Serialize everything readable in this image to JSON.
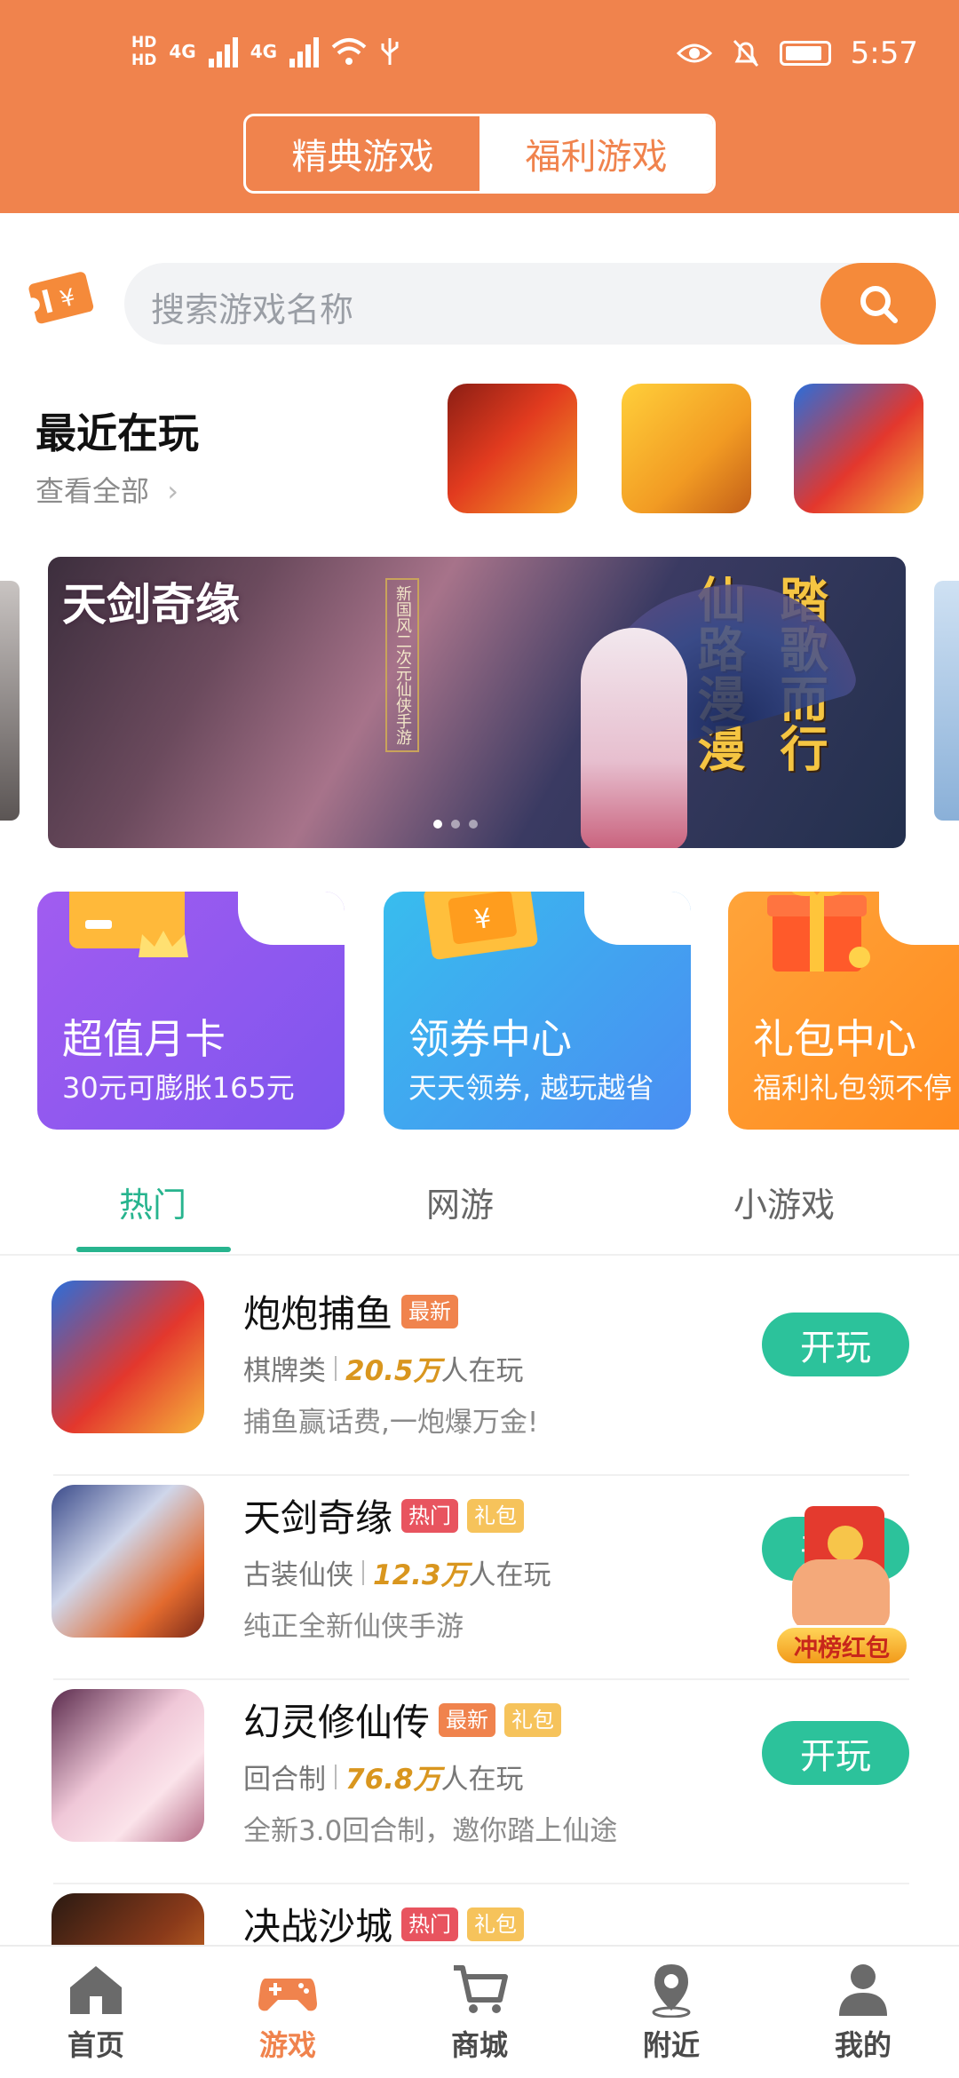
{
  "status_bar": {
    "time": "5:57",
    "hd1": "HD",
    "hd2": "HD",
    "net1": "4G",
    "net2": "4G"
  },
  "header": {
    "tabs": [
      {
        "label": "精典游戏",
        "active": false
      },
      {
        "label": "福利游戏",
        "active": true
      }
    ]
  },
  "search": {
    "placeholder": "搜索游戏名称"
  },
  "recent": {
    "title": "最近在玩",
    "more": "查看全部"
  },
  "banner": {
    "logo": "天剑奇缘",
    "poem_col1": "踏歌而行",
    "poem_col2": "仙路漫漫",
    "tagline": "新国风二次元仙侠手游"
  },
  "promos": [
    {
      "title": "超值月卡",
      "subtitle": "30元可膨胀165元"
    },
    {
      "title": "领券中心",
      "subtitle": "天天领券, 越玩越省"
    },
    {
      "title": "礼包中心",
      "subtitle": "福利礼包领不停"
    }
  ],
  "category_tabs": [
    {
      "label": "热门",
      "active": true
    },
    {
      "label": "网游",
      "active": false
    },
    {
      "label": "小游戏",
      "active": false
    }
  ],
  "games": [
    {
      "name": "炮炮捕鱼",
      "badges": [
        "最新"
      ],
      "genre": "棋牌类",
      "players": "20.5万",
      "players_suffix": "人在玩",
      "desc": "捕鱼赢话费,一炮爆万金!",
      "button": "开玩"
    },
    {
      "name": "天剑奇缘",
      "badges": [
        "热门",
        "礼包"
      ],
      "genre": "古装仙侠",
      "players": "12.3万",
      "players_suffix": "人在玩",
      "desc": "纯正全新仙侠手游",
      "button": "开玩"
    },
    {
      "name": "幻灵修仙传",
      "badges": [
        "最新",
        "礼包"
      ],
      "genre": "回合制",
      "players": "76.8万",
      "players_suffix": "人在玩",
      "desc": "全新3.0回合制，邀你踏上仙途",
      "button": "开玩"
    },
    {
      "name": "决战沙城",
      "badges": [
        "热门",
        "礼包"
      ]
    }
  ],
  "float_redpacket": {
    "label": "冲榜红包"
  },
  "bottom_nav": [
    {
      "label": "首页",
      "icon": "home-icon",
      "active": false
    },
    {
      "label": "游戏",
      "icon": "gamepad-icon",
      "active": true
    },
    {
      "label": "商城",
      "icon": "cart-icon",
      "active": false
    },
    {
      "label": "附近",
      "icon": "location-icon",
      "active": false
    },
    {
      "label": "我的",
      "icon": "user-icon",
      "active": false
    }
  ],
  "colors": {
    "brand": "#f0834d",
    "accent_green": "#2cc29b",
    "tab_green": "#27b48e"
  }
}
